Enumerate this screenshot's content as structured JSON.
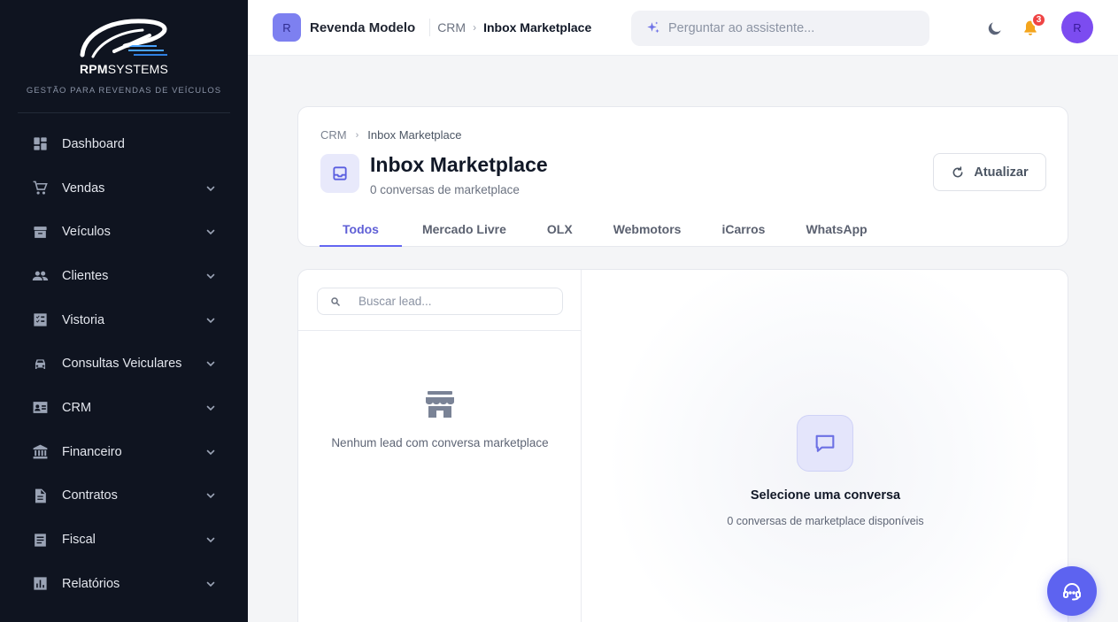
{
  "brand": {
    "name_bold": "RPM",
    "name_rest": "SYSTEMS",
    "tagline": "GESTÃO PARA REVENDAS DE VEÍCULOS"
  },
  "sidebar": {
    "items": [
      {
        "label": "Dashboard",
        "icon": "dashboard-icon",
        "expandable": false
      },
      {
        "label": "Vendas",
        "icon": "cart-icon",
        "expandable": true
      },
      {
        "label": "Veículos",
        "icon": "archive-icon",
        "expandable": true
      },
      {
        "label": "Clientes",
        "icon": "people-icon",
        "expandable": true
      },
      {
        "label": "Vistoria",
        "icon": "checklist-icon",
        "expandable": true
      },
      {
        "label": "Consultas Veiculares",
        "icon": "car-icon",
        "expandable": true
      },
      {
        "label": "CRM",
        "icon": "contact-card-icon",
        "expandable": true
      },
      {
        "label": "Financeiro",
        "icon": "bank-icon",
        "expandable": true
      },
      {
        "label": "Contratos",
        "icon": "document-icon",
        "expandable": true
      },
      {
        "label": "Fiscal",
        "icon": "receipt-icon",
        "expandable": true
      },
      {
        "label": "Relatórios",
        "icon": "bar-chart-icon",
        "expandable": true
      }
    ]
  },
  "header": {
    "org_initial": "R",
    "org_name": "Revenda Modelo",
    "breadcrumb": [
      "CRM",
      "Inbox Marketplace"
    ],
    "assistant_placeholder": "Perguntar ao assistente...",
    "notification_count": "3",
    "user_initial": "R"
  },
  "page": {
    "breadcrumb": [
      "CRM",
      "Inbox Marketplace"
    ],
    "title": "Inbox Marketplace",
    "subtitle": "0 conversas de marketplace",
    "refresh_label": "Atualizar",
    "tabs": [
      "Todos",
      "Mercado Livre",
      "OLX",
      "Webmotors",
      "iCarros",
      "WhatsApp"
    ],
    "active_tab": "Todos"
  },
  "inbox": {
    "search_placeholder": "Buscar lead...",
    "empty_leads": "Nenhum lead com conversa marketplace",
    "empty_chat_title": "Selecione uma conversa",
    "empty_chat_subtitle": "0 conversas de marketplace disponíveis"
  },
  "colors": {
    "sidebar_bg": "#0f1420",
    "accent": "#6366f1",
    "notification": "#ef4444",
    "bell": "#f4a51c"
  }
}
